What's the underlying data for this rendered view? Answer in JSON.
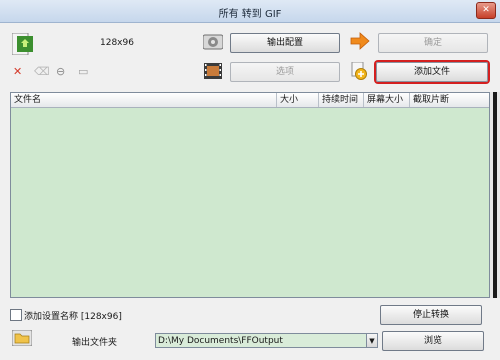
{
  "window": {
    "title": "所有 转到 GIF"
  },
  "preset": {
    "label": "128x96"
  },
  "buttons": {
    "output_config": "输出配置",
    "confirm": "确定",
    "options": "选项",
    "add_file": "添加文件",
    "stop_convert": "停止转换",
    "browse": "浏览"
  },
  "table": {
    "columns": [
      "文件名",
      "大小",
      "持续时间",
      "屏幕大小",
      "截取片断"
    ],
    "rows": []
  },
  "settings": {
    "add_setting_name_label": "添加设置名称 [128x96]",
    "add_setting_name_checked": false
  },
  "output": {
    "folder_label": "输出文件夹",
    "folder_path": "D:\\My Documents\\FFOutput"
  },
  "colors": {
    "list_background": "#cfe8cf",
    "highlight_border": "#d42020",
    "confirm_arrow": "#f08a1c"
  }
}
